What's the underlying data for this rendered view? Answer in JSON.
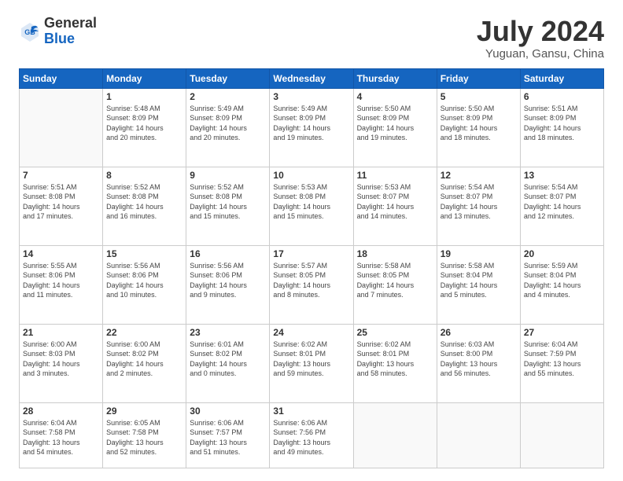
{
  "header": {
    "logo_general": "General",
    "logo_blue": "Blue",
    "month": "July 2024",
    "location": "Yuguan, Gansu, China"
  },
  "days_of_week": [
    "Sunday",
    "Monday",
    "Tuesday",
    "Wednesday",
    "Thursday",
    "Friday",
    "Saturday"
  ],
  "weeks": [
    [
      {
        "day": "",
        "info": ""
      },
      {
        "day": "1",
        "info": "Sunrise: 5:48 AM\nSunset: 8:09 PM\nDaylight: 14 hours\nand 20 minutes."
      },
      {
        "day": "2",
        "info": "Sunrise: 5:49 AM\nSunset: 8:09 PM\nDaylight: 14 hours\nand 20 minutes."
      },
      {
        "day": "3",
        "info": "Sunrise: 5:49 AM\nSunset: 8:09 PM\nDaylight: 14 hours\nand 19 minutes."
      },
      {
        "day": "4",
        "info": "Sunrise: 5:50 AM\nSunset: 8:09 PM\nDaylight: 14 hours\nand 19 minutes."
      },
      {
        "day": "5",
        "info": "Sunrise: 5:50 AM\nSunset: 8:09 PM\nDaylight: 14 hours\nand 18 minutes."
      },
      {
        "day": "6",
        "info": "Sunrise: 5:51 AM\nSunset: 8:09 PM\nDaylight: 14 hours\nand 18 minutes."
      }
    ],
    [
      {
        "day": "7",
        "info": "Sunrise: 5:51 AM\nSunset: 8:08 PM\nDaylight: 14 hours\nand 17 minutes."
      },
      {
        "day": "8",
        "info": "Sunrise: 5:52 AM\nSunset: 8:08 PM\nDaylight: 14 hours\nand 16 minutes."
      },
      {
        "day": "9",
        "info": "Sunrise: 5:52 AM\nSunset: 8:08 PM\nDaylight: 14 hours\nand 15 minutes."
      },
      {
        "day": "10",
        "info": "Sunrise: 5:53 AM\nSunset: 8:08 PM\nDaylight: 14 hours\nand 15 minutes."
      },
      {
        "day": "11",
        "info": "Sunrise: 5:53 AM\nSunset: 8:07 PM\nDaylight: 14 hours\nand 14 minutes."
      },
      {
        "day": "12",
        "info": "Sunrise: 5:54 AM\nSunset: 8:07 PM\nDaylight: 14 hours\nand 13 minutes."
      },
      {
        "day": "13",
        "info": "Sunrise: 5:54 AM\nSunset: 8:07 PM\nDaylight: 14 hours\nand 12 minutes."
      }
    ],
    [
      {
        "day": "14",
        "info": "Sunrise: 5:55 AM\nSunset: 8:06 PM\nDaylight: 14 hours\nand 11 minutes."
      },
      {
        "day": "15",
        "info": "Sunrise: 5:56 AM\nSunset: 8:06 PM\nDaylight: 14 hours\nand 10 minutes."
      },
      {
        "day": "16",
        "info": "Sunrise: 5:56 AM\nSunset: 8:06 PM\nDaylight: 14 hours\nand 9 minutes."
      },
      {
        "day": "17",
        "info": "Sunrise: 5:57 AM\nSunset: 8:05 PM\nDaylight: 14 hours\nand 8 minutes."
      },
      {
        "day": "18",
        "info": "Sunrise: 5:58 AM\nSunset: 8:05 PM\nDaylight: 14 hours\nand 7 minutes."
      },
      {
        "day": "19",
        "info": "Sunrise: 5:58 AM\nSunset: 8:04 PM\nDaylight: 14 hours\nand 5 minutes."
      },
      {
        "day": "20",
        "info": "Sunrise: 5:59 AM\nSunset: 8:04 PM\nDaylight: 14 hours\nand 4 minutes."
      }
    ],
    [
      {
        "day": "21",
        "info": "Sunrise: 6:00 AM\nSunset: 8:03 PM\nDaylight: 14 hours\nand 3 minutes."
      },
      {
        "day": "22",
        "info": "Sunrise: 6:00 AM\nSunset: 8:02 PM\nDaylight: 14 hours\nand 2 minutes."
      },
      {
        "day": "23",
        "info": "Sunrise: 6:01 AM\nSunset: 8:02 PM\nDaylight: 14 hours\nand 0 minutes."
      },
      {
        "day": "24",
        "info": "Sunrise: 6:02 AM\nSunset: 8:01 PM\nDaylight: 13 hours\nand 59 minutes."
      },
      {
        "day": "25",
        "info": "Sunrise: 6:02 AM\nSunset: 8:01 PM\nDaylight: 13 hours\nand 58 minutes."
      },
      {
        "day": "26",
        "info": "Sunrise: 6:03 AM\nSunset: 8:00 PM\nDaylight: 13 hours\nand 56 minutes."
      },
      {
        "day": "27",
        "info": "Sunrise: 6:04 AM\nSunset: 7:59 PM\nDaylight: 13 hours\nand 55 minutes."
      }
    ],
    [
      {
        "day": "28",
        "info": "Sunrise: 6:04 AM\nSunset: 7:58 PM\nDaylight: 13 hours\nand 54 minutes."
      },
      {
        "day": "29",
        "info": "Sunrise: 6:05 AM\nSunset: 7:58 PM\nDaylight: 13 hours\nand 52 minutes."
      },
      {
        "day": "30",
        "info": "Sunrise: 6:06 AM\nSunset: 7:57 PM\nDaylight: 13 hours\nand 51 minutes."
      },
      {
        "day": "31",
        "info": "Sunrise: 6:06 AM\nSunset: 7:56 PM\nDaylight: 13 hours\nand 49 minutes."
      },
      {
        "day": "",
        "info": ""
      },
      {
        "day": "",
        "info": ""
      },
      {
        "day": "",
        "info": ""
      }
    ]
  ]
}
